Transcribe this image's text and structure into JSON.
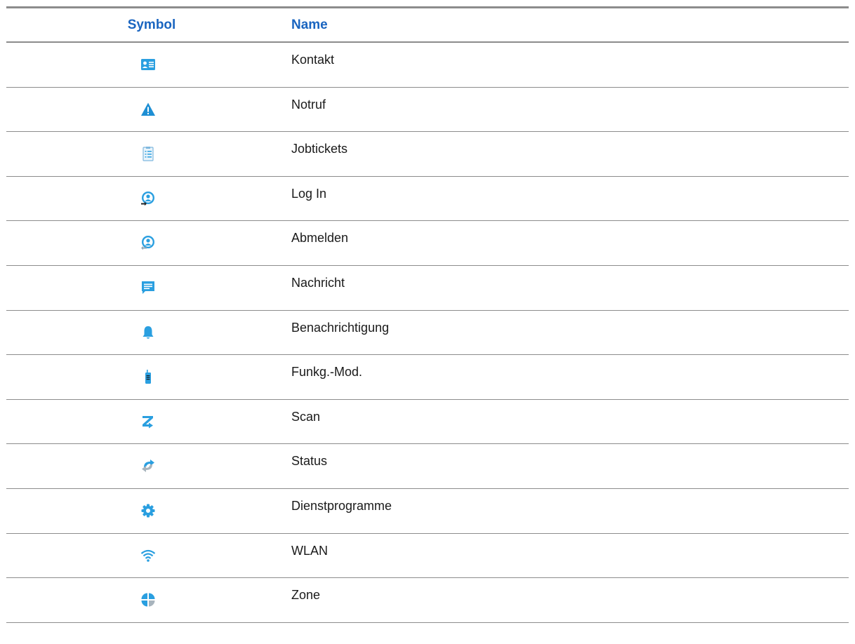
{
  "table": {
    "headers": {
      "symbol": "Symbol",
      "name": "Name"
    },
    "rows": [
      {
        "icon": "contact-card-icon",
        "name": "Kontakt"
      },
      {
        "icon": "warning-triangle-icon",
        "name": "Notruf"
      },
      {
        "icon": "clipboard-list-icon",
        "name": "Jobtickets"
      },
      {
        "icon": "user-login-icon",
        "name": "Log In"
      },
      {
        "icon": "user-logout-icon",
        "name": "Abmelden"
      },
      {
        "icon": "message-bubble-icon",
        "name": "Nachricht"
      },
      {
        "icon": "bell-icon",
        "name": "Benachrichtigung"
      },
      {
        "icon": "radio-device-icon",
        "name": "Funkg.-Mod."
      },
      {
        "icon": "scan-z-icon",
        "name": "Scan"
      },
      {
        "icon": "status-arrows-icon",
        "name": "Status"
      },
      {
        "icon": "gear-icon",
        "name": "Dienstprogramme"
      },
      {
        "icon": "wifi-icon",
        "name": "WLAN"
      },
      {
        "icon": "zone-pie-icon",
        "name": "Zone"
      }
    ]
  },
  "colors": {
    "header_text": "#1a65c0",
    "icon_blue": "#2a9fe0",
    "rule": "#8c8c8c"
  }
}
